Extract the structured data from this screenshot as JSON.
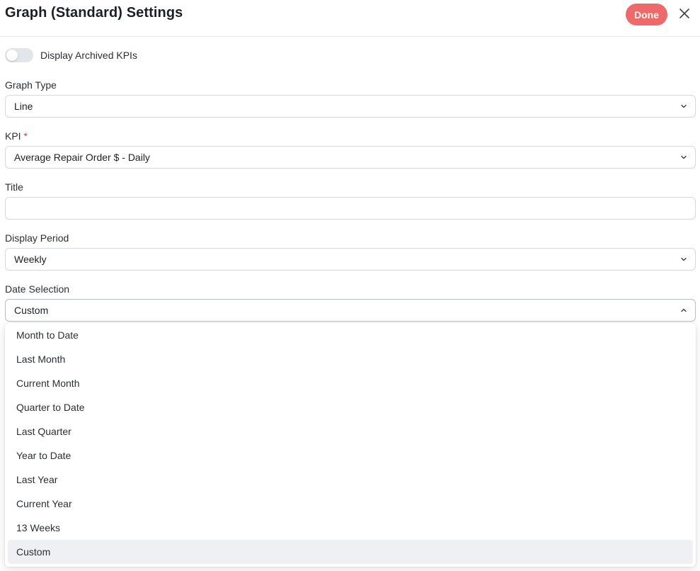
{
  "header": {
    "title": "Graph (Standard) Settings",
    "done_label": "Done",
    "done_color": "#ee6a6a"
  },
  "archived_toggle": {
    "label": "Display Archived KPIs",
    "on": false
  },
  "graph_type": {
    "label": "Graph Type",
    "value": "Line"
  },
  "kpi": {
    "label": "KPI",
    "required_mark": "*",
    "value": "Average Repair Order $ - Daily"
  },
  "title_field": {
    "label": "Title",
    "value": ""
  },
  "display_period": {
    "label": "Display Period",
    "value": "Weekly"
  },
  "date_selection": {
    "label": "Date Selection",
    "value": "Custom",
    "options": [
      "Month to Date",
      "Last Month",
      "Current Month",
      "Quarter to Date",
      "Last Quarter",
      "Year to Date",
      "Last Year",
      "Current Year",
      "13 Weeks",
      "Custom"
    ],
    "selected_index": 9
  },
  "icons": {
    "close": "close-icon",
    "chevron_down": "chevron-down-icon",
    "chevron_up": "chevron-up-icon"
  }
}
